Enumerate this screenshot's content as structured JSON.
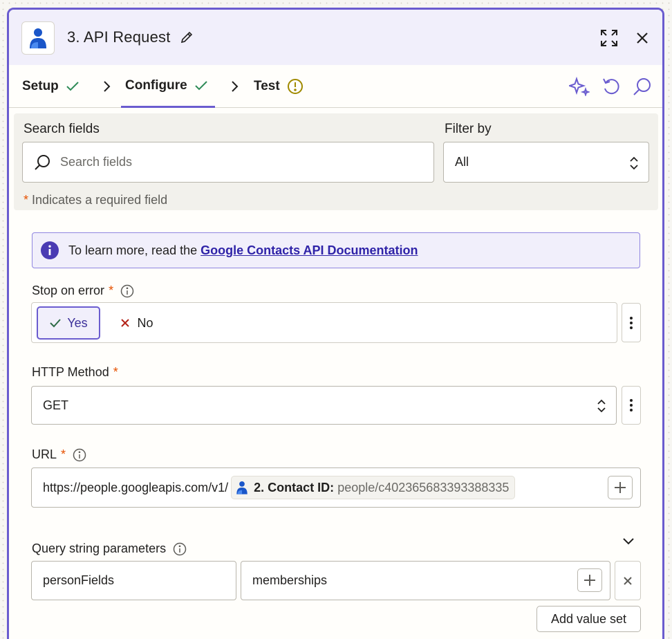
{
  "header": {
    "title": "3. API Request",
    "app_icon": "person-icon"
  },
  "tabs": [
    {
      "label": "Setup",
      "status": "complete"
    },
    {
      "label": "Configure",
      "status": "complete",
      "active": true
    },
    {
      "label": "Test",
      "status": "warning"
    }
  ],
  "search": {
    "label": "Search fields",
    "placeholder": "Search fields"
  },
  "filter": {
    "label": "Filter by",
    "value": "All"
  },
  "required_note": {
    "star": "*",
    "text": "Indicates a required field"
  },
  "info": {
    "text": "To learn more, read the",
    "link": "Google Contacts API Documentation"
  },
  "stop_on_error": {
    "label": "Stop on error",
    "required": "*",
    "yes_label": "Yes",
    "no_label": "No",
    "selected": "Yes"
  },
  "http_method": {
    "label": "HTTP Method",
    "required": "*",
    "value": "GET"
  },
  "url": {
    "label": "URL",
    "required": "*",
    "prefix": "https://people.googleapis.com/v1/",
    "pill_label": "2. Contact ID:",
    "pill_value": "people/c402365683393388335"
  },
  "query_params": {
    "label": "Query string parameters",
    "key": "personFields",
    "value": "memberships",
    "add_label": "Add value set"
  },
  "colors": {
    "accent": "#6a5ccf",
    "success": "#2e8b57",
    "warning": "#a08a00",
    "required": "#e65100",
    "link": "#2f23a8"
  }
}
